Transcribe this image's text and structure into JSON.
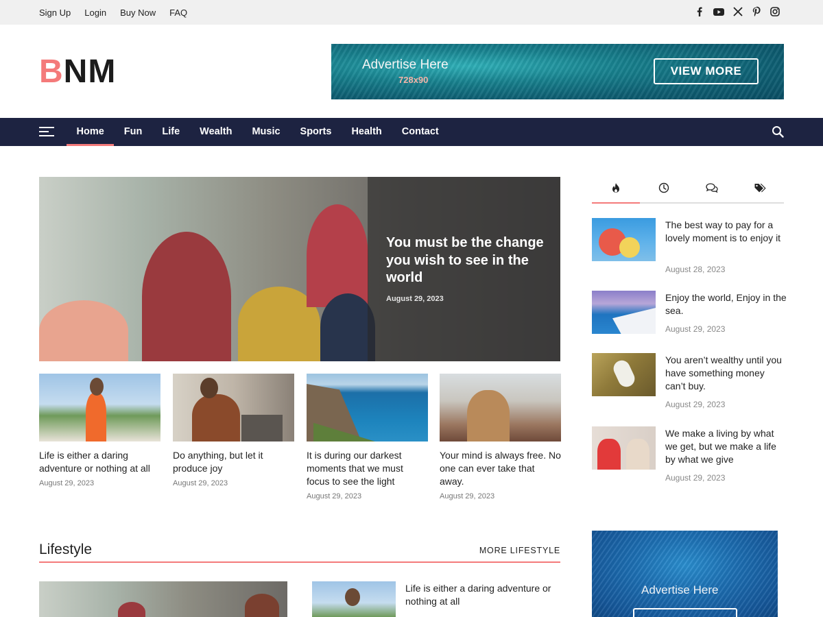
{
  "topbar": {
    "links": [
      "Sign Up",
      "Login",
      "Buy Now",
      "FAQ"
    ],
    "social_icons": [
      "facebook-icon",
      "youtube-icon",
      "x-icon",
      "pinterest-icon",
      "instagram-icon"
    ]
  },
  "header": {
    "logo_first": "B",
    "logo_rest": "NM",
    "ad": {
      "title": "Advertise Here",
      "size": "728x90",
      "button": "VIEW MORE"
    }
  },
  "nav": {
    "items": [
      "Home",
      "Fun",
      "Life",
      "Wealth",
      "Music",
      "Sports",
      "Health",
      "Contact"
    ],
    "active": "Home"
  },
  "hero": {
    "title": "You must be the change you wish to see in the world",
    "date": "August 29, 2023"
  },
  "cards": [
    {
      "title": "Life is either a daring adventure or nothing at all",
      "date": "August 29, 2023"
    },
    {
      "title": "Do anything, but let it produce joy",
      "date": "August 29, 2023"
    },
    {
      "title": "It is during our darkest moments that we must focus to see the light",
      "date": "August 29, 2023"
    },
    {
      "title": "Your mind is always free. No one can ever take that away.",
      "date": "August 29, 2023"
    }
  ],
  "sidebar": {
    "tabs": [
      "fire-icon",
      "clock-icon",
      "comments-icon",
      "tags-icon"
    ],
    "posts": [
      {
        "title": "The best way to pay for a lovely moment is to enjoy it",
        "date": "August 28, 2023"
      },
      {
        "title": "Enjoy the world, Enjoy in the sea.",
        "date": "August 29, 2023"
      },
      {
        "title": "You aren’t wealthy until you have something money can’t buy.",
        "date": "August 29, 2023"
      },
      {
        "title": "We make a living by what we get, but we make a life by what we give",
        "date": "August 29, 2023"
      }
    ],
    "ad": {
      "title": "Advertise Here"
    }
  },
  "lifestyle": {
    "title": "Lifestyle",
    "more": "MORE LIFESTYLE",
    "post_title": "Life is either a daring adventure or nothing at all"
  },
  "colors": {
    "accent": "#f47a7a",
    "nav_bg": "#1d2341",
    "topbar_bg": "#f0f0f0"
  }
}
